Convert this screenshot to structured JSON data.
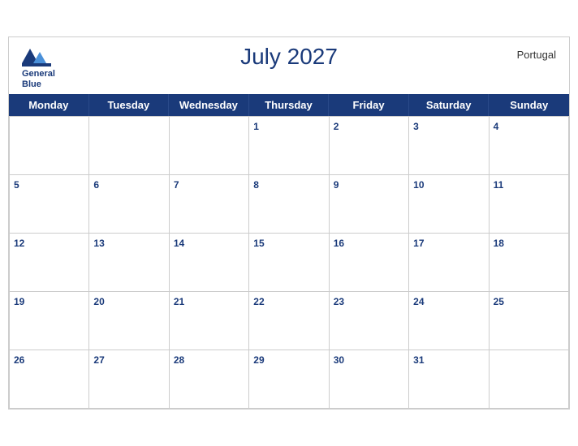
{
  "header": {
    "title": "July 2027",
    "country": "Portugal",
    "logo_line1": "General",
    "logo_line2": "Blue"
  },
  "dayHeaders": [
    "Monday",
    "Tuesday",
    "Wednesday",
    "Thursday",
    "Friday",
    "Saturday",
    "Sunday"
  ],
  "weeks": [
    [
      "",
      "",
      "",
      "1",
      "2",
      "3",
      "4"
    ],
    [
      "5",
      "6",
      "7",
      "8",
      "9",
      "10",
      "11"
    ],
    [
      "12",
      "13",
      "14",
      "15",
      "16",
      "17",
      "18"
    ],
    [
      "19",
      "20",
      "21",
      "22",
      "23",
      "24",
      "25"
    ],
    [
      "26",
      "27",
      "28",
      "29",
      "30",
      "31",
      ""
    ]
  ]
}
